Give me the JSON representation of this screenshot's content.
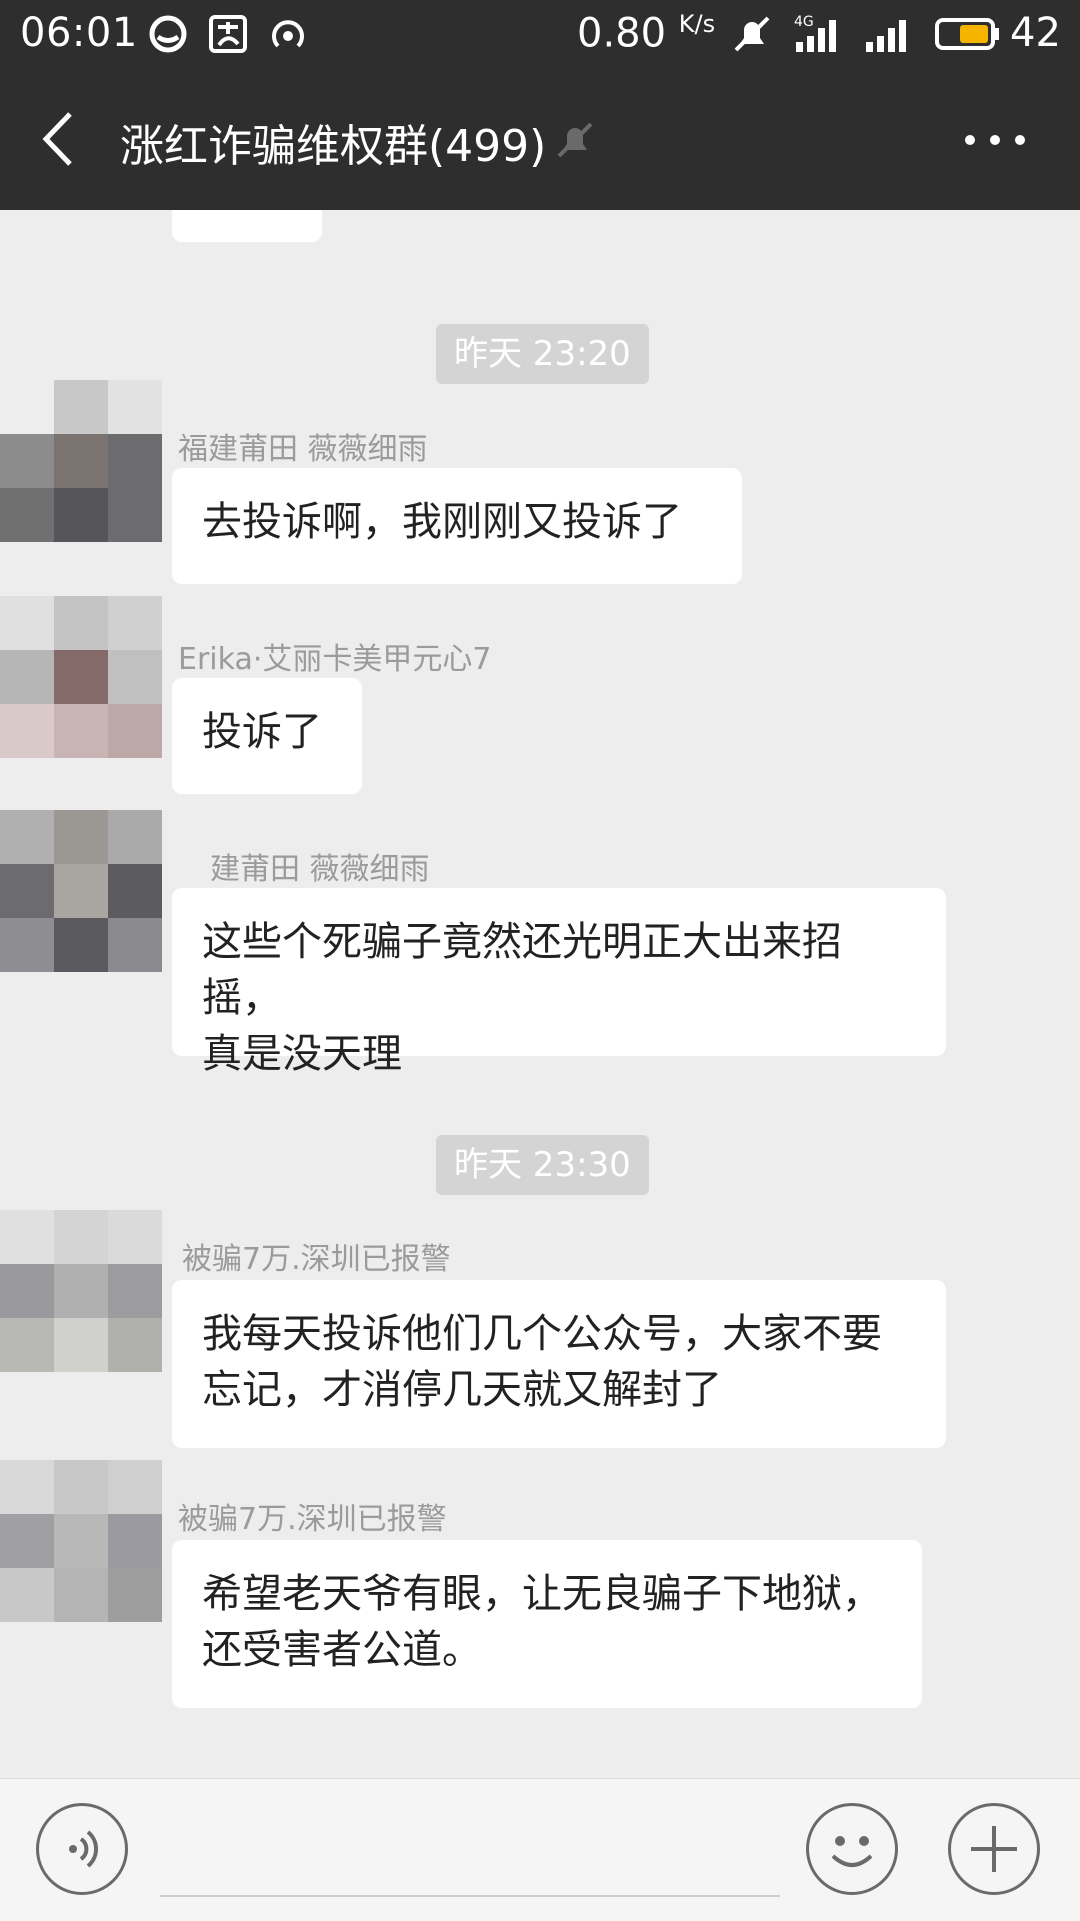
{
  "status_bar": {
    "time": "06:01",
    "net_speed": "0.80",
    "net_unit": "K/s",
    "network_type": "4G",
    "battery": "42",
    "icons": [
      "wechat-icon",
      "alipay-icon",
      "hotspot-icon",
      "mute-bell-icon",
      "signal-icon",
      "battery-icon"
    ]
  },
  "header": {
    "title": "涨红诈骗维权群(499)",
    "back_icon": "chevron-left-icon",
    "mute_icon": "bell-off-icon",
    "more_icon": "more-dots-icon"
  },
  "messages": [
    {
      "type": "time",
      "text": "昨天 23:20"
    },
    {
      "type": "msg",
      "sender": "福建莆田 薇薇细雨",
      "text": "去投诉啊，我刚刚又投诉了"
    },
    {
      "type": "msg",
      "sender": "Erika·艾丽卡美甲元心7",
      "text": "投诉了"
    },
    {
      "type": "msg",
      "sender": "建莆田 薇薇细雨",
      "text_lines": [
        "这些个死骗子竟然还光明正大出来招摇，",
        "真是没天理"
      ]
    },
    {
      "type": "time",
      "text": "昨天 23:30"
    },
    {
      "type": "msg",
      "sender": "被骗7万.深圳已报警",
      "text_lines": [
        "我每天投诉他们几个公众号，大家不要",
        "忘记，才消停几天就又解封了"
      ]
    },
    {
      "type": "msg",
      "sender": "被骗7万.深圳已报警",
      "text_lines": [
        "希望老天爷有眼，让无良骗子下地狱，",
        "还受害者公道。"
      ]
    }
  ],
  "input_bar": {
    "voice_icon": "voice-icon",
    "emoji_icon": "emoji-icon",
    "add_icon": "plus-icon"
  },
  "colors": {
    "header_bg": "#2e2e2e",
    "chat_bg": "#ededed",
    "time_chip_bg": "#d4d4d4",
    "bubble_bg": "#ffffff"
  }
}
